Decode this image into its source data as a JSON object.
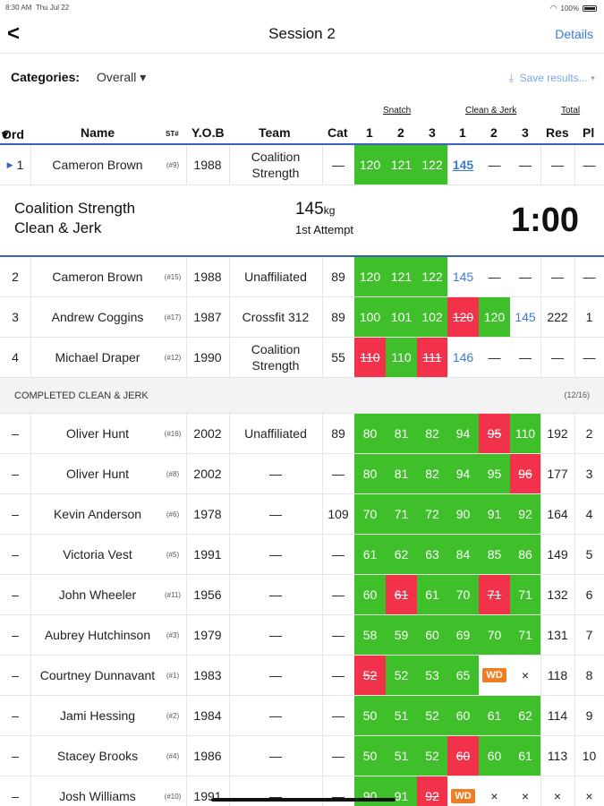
{
  "status": {
    "time": "8:30 AM",
    "date": "Thu Jul 22",
    "battery": "100%"
  },
  "nav": {
    "back": "<",
    "title": "Session 2",
    "details": "Details"
  },
  "toolbar": {
    "categories_label": "Categories:",
    "categories_value": "Overall",
    "save": "Save results..."
  },
  "header": {
    "ord": "Ord",
    "name": "Name",
    "st": "ST#",
    "yob": "Y.O.B",
    "team": "Team",
    "cat": "Cat",
    "snatch": "Snatch",
    "cj": "Clean & Jerk",
    "total": "Total",
    "a1": "1",
    "a2": "2",
    "a3": "3",
    "b1": "1",
    "b2": "2",
    "b3": "3",
    "res": "Res",
    "pl": "Pl"
  },
  "current": {
    "ord": "1",
    "name": "Cameron Brown",
    "st": "(#9)",
    "yob": "1988",
    "team": "Coalition Strength",
    "cat": "—",
    "s1": "120",
    "s2": "121",
    "s3": "122",
    "c1": "145",
    "c2": "—",
    "c3": "—",
    "res": "—",
    "pl": "—"
  },
  "banner": {
    "team": "Coalition Strength",
    "lift": "Clean & Jerk",
    "weight": "145",
    "unit": "kg",
    "attempt": "1st Attempt",
    "clock": "1:00"
  },
  "upcoming": [
    {
      "ord": "2",
      "name": "Cameron Brown",
      "st": "(#15)",
      "yob": "1988",
      "team": "Unaffiliated",
      "cat": "89",
      "s1": "120",
      "s2": "121",
      "s3": "122",
      "c1": "145",
      "c2": "—",
      "c3": "—",
      "res": "—",
      "pl": "—"
    },
    {
      "ord": "3",
      "name": "Andrew Coggins",
      "st": "(#17)",
      "yob": "1987",
      "team": "Crossfit 312",
      "cat": "89",
      "s1": "100",
      "s2": "101",
      "s3": "102",
      "c1": "120",
      "c2": "120",
      "c3": "145",
      "res": "222",
      "pl": "1"
    },
    {
      "ord": "4",
      "name": "Michael Draper",
      "st": "(#12)",
      "yob": "1990",
      "team": "Coalition Strength",
      "cat": "55",
      "s1": "110",
      "s2": "110",
      "s3": "111",
      "c1": "146",
      "c2": "—",
      "c3": "—",
      "res": "—",
      "pl": "—"
    }
  ],
  "section": {
    "label": "COMPLETED CLEAN & JERK",
    "count": "(12/16)"
  },
  "completed": [
    {
      "ord": "–",
      "name": "Oliver Hunt",
      "st": "(#16)",
      "yob": "2002",
      "team": "Unaffiliated",
      "cat": "89",
      "s1": "80",
      "s2": "81",
      "s3": "82",
      "c1": "94",
      "c2": "95",
      "c3": "110",
      "res": "192",
      "pl": "2"
    },
    {
      "ord": "–",
      "name": "Oliver Hunt",
      "st": "(#8)",
      "yob": "2002",
      "team": "—",
      "cat": "—",
      "s1": "80",
      "s2": "81",
      "s3": "82",
      "c1": "94",
      "c2": "95",
      "c3": "96",
      "res": "177",
      "pl": "3"
    },
    {
      "ord": "–",
      "name": "Kevin Anderson",
      "st": "(#6)",
      "yob": "1978",
      "team": "—",
      "cat": "109",
      "s1": "70",
      "s2": "71",
      "s3": "72",
      "c1": "90",
      "c2": "91",
      "c3": "92",
      "res": "164",
      "pl": "4"
    },
    {
      "ord": "–",
      "name": "Victoria Vest",
      "st": "(#5)",
      "yob": "1991",
      "team": "—",
      "cat": "—",
      "s1": "61",
      "s2": "62",
      "s3": "63",
      "c1": "84",
      "c2": "85",
      "c3": "86",
      "res": "149",
      "pl": "5"
    },
    {
      "ord": "–",
      "name": "John Wheeler",
      "st": "(#11)",
      "yob": "1956",
      "team": "—",
      "cat": "—",
      "s1": "60",
      "s2": "61",
      "s3": "61",
      "c1": "70",
      "c2": "71",
      "c3": "71",
      "res": "132",
      "pl": "6"
    },
    {
      "ord": "–",
      "name": "Aubrey Hutchinson",
      "st": "(#3)",
      "yob": "1979",
      "team": "—",
      "cat": "—",
      "s1": "58",
      "s2": "59",
      "s3": "60",
      "c1": "69",
      "c2": "70",
      "c3": "71",
      "res": "131",
      "pl": "7"
    },
    {
      "ord": "–",
      "name": "Courtney Dunnavant",
      "st": "(#1)",
      "yob": "1983",
      "team": "—",
      "cat": "—",
      "s1": "52",
      "s2": "52",
      "s3": "53",
      "c1": "65",
      "c2": "WD",
      "c3": "×",
      "res": "118",
      "pl": "8"
    },
    {
      "ord": "–",
      "name": "Jami Hessing",
      "st": "(#2)",
      "yob": "1984",
      "team": "—",
      "cat": "—",
      "s1": "50",
      "s2": "51",
      "s3": "52",
      "c1": "60",
      "c2": "61",
      "c3": "62",
      "res": "114",
      "pl": "9"
    },
    {
      "ord": "–",
      "name": "Stacey Brooks",
      "st": "(#4)",
      "yob": "1986",
      "team": "—",
      "cat": "—",
      "s1": "50",
      "s2": "51",
      "s3": "52",
      "c1": "60",
      "c2": "60",
      "c3": "61",
      "res": "113",
      "pl": "10"
    },
    {
      "ord": "–",
      "name": "Josh Williams",
      "st": "(#10)",
      "yob": "1991",
      "team": "—",
      "cat": "—",
      "s1": "90",
      "s2": "91",
      "s3": "92",
      "c1": "WD",
      "c2": "×",
      "c3": "×",
      "res": "×",
      "pl": "×"
    }
  ],
  "colors": {
    "good": "#3fbf2a",
    "miss": "#f2314a",
    "withdrawn": "#f07d24",
    "accent": "#3a7bd5"
  }
}
